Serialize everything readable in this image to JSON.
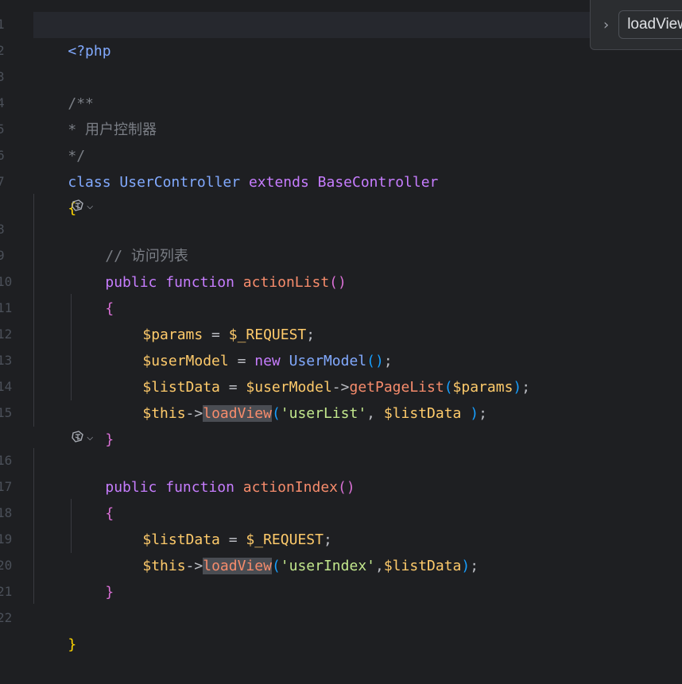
{
  "editor": {
    "gutter_numbers": [
      "1",
      "2",
      "3",
      "4",
      "5",
      "6",
      "7",
      "8",
      "9",
      "10",
      "11",
      "12",
      "13",
      "14",
      "15",
      "16",
      "17",
      "18",
      "19",
      "20",
      "21",
      "22"
    ],
    "lines": {
      "l1": "<?php",
      "l3": "/**",
      "l4": "* 用户控制器",
      "l5": "*/",
      "l6_kw": "class",
      "l6_name": "UserController",
      "l6_ext": "extends",
      "l6_base": "BaseController",
      "l7": "{",
      "l8": "// 访问列表",
      "l9_kw1": "public",
      "l9_kw2": "function",
      "l9_fn": "actionList",
      "l9_paren": "()",
      "l10": "{",
      "l11_var": "$params",
      "l11_eq": " = ",
      "l11_val": "$_REQUEST",
      "l11_end": ";",
      "l12_var": "$userModel",
      "l12_eq": " = ",
      "l12_new": "new",
      "l12_cls": "UserModel",
      "l12_paren": "()",
      "l12_end": ";",
      "l13_var": "$listData",
      "l13_eq": " = ",
      "l13_obj": "$userModel",
      "l13_arrow": "->",
      "l13_fn": "getPageList",
      "l13_open": "(",
      "l13_arg": "$params",
      "l13_close": ")",
      "l13_end": ";",
      "l14_this": "$this",
      "l14_arrow": "->",
      "l14_fn": "loadView",
      "l14_open": "(",
      "l14_str": "'userList'",
      "l14_comma": ", ",
      "l14_arg": "$listData",
      "l14_close": " )",
      "l14_end": ";",
      "l15": "}",
      "l16_kw1": "public",
      "l16_kw2": "function",
      "l16_fn": "actionIndex",
      "l16_paren": "()",
      "l17": "{",
      "l18_var": "$listData",
      "l18_eq": " = ",
      "l18_val": "$_REQUEST",
      "l18_end": ";",
      "l19_this": "$this",
      "l19_arrow": "->",
      "l19_fn": "loadView",
      "l19_open": "(",
      "l19_str": "'userIndex'",
      "l19_comma": ",",
      "l19_arg": "$listData",
      "l19_close": ")",
      "l19_end": ";",
      "l20": "}",
      "l22": "}"
    },
    "inlay_icon": "ai-assist-icon",
    "inlay_chevron": "⌵"
  },
  "popup": {
    "chevron": "›",
    "search_text": "loadView"
  }
}
